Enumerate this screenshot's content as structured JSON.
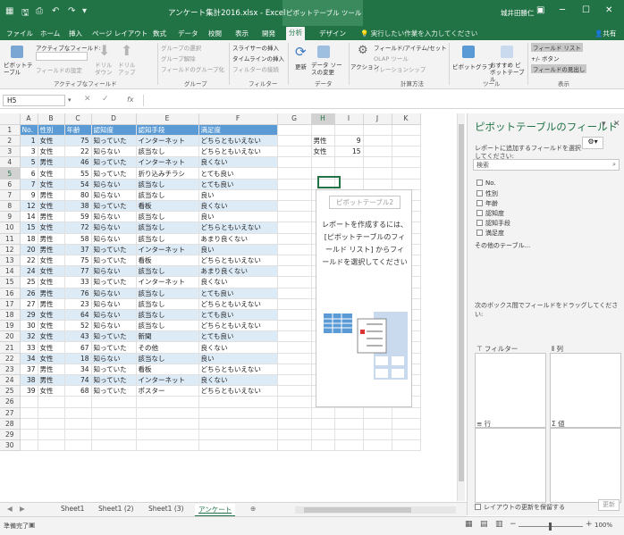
{
  "window": {
    "title": "アンケート集計2016.xlsx - Excel",
    "context_tab_group": "ピボットテーブル ツール",
    "user": "城井田勝仁"
  },
  "menu_tabs": [
    "ファイル",
    "ホーム",
    "挿入",
    "ページ レイアウト",
    "数式",
    "データ",
    "校閲",
    "表示",
    "開発",
    "分析",
    "デザイン"
  ],
  "tell_me": "実行したい作業を入力してください",
  "share": "共有",
  "ribbon": {
    "pivot_name_label": "アクティブなフィールド:",
    "pivot_btn": "ピボットテーブル",
    "field_settings": "フィールドの設定",
    "drill_down": "ドリル ダウン",
    "drill_up": "ドリル アップ",
    "group_selection": "グループの選択",
    "ungroup": "グループ解除",
    "group_field": "フィールドのグループ化",
    "insert_slicer": "スライサーの挿入",
    "insert_timeline": "タイムラインの挿入",
    "filter_conn": "フィルターの接続",
    "refresh": "更新",
    "change_source": "データ ソースの変更",
    "actions": "アクション",
    "fields_items": "フィールド/アイテム/セット",
    "olap": "OLAP ツール",
    "relationships": "リレーションシップ",
    "pivot_chart": "ピボットグラフ",
    "recommended": "おすすめ ピボットテーブル",
    "field_list": "フィールド リスト",
    "buttons": "+/- ボタン",
    "field_headers": "フィールドの見出し",
    "groups": [
      "アクティブなフィールド",
      "グループ",
      "フィルター",
      "データ",
      "計算方法",
      "ツール",
      "表示"
    ]
  },
  "namebox": "H5",
  "fx": "fx",
  "columns": [
    "A",
    "B",
    "C",
    "D",
    "E",
    "F",
    "G",
    "H",
    "I",
    "J",
    "K"
  ],
  "selected_column": "H",
  "selected_row": "5",
  "table_header": [
    "No.",
    "性別",
    "年齢",
    "認知度",
    "認知手段",
    "満足度"
  ],
  "rows": [
    [
      "1",
      "女性",
      "75",
      "知っていた",
      "インターネット",
      "どちらともいえない"
    ],
    [
      "3",
      "女性",
      "22",
      "知らない",
      "該当なし",
      "どちらともいえない"
    ],
    [
      "5",
      "男性",
      "46",
      "知っていた",
      "インターネット",
      "良くない"
    ],
    [
      "6",
      "女性",
      "55",
      "知っていた",
      "折り込みチラシ",
      "とても良い"
    ],
    [
      "7",
      "女性",
      "54",
      "知らない",
      "該当なし",
      "とても良い"
    ],
    [
      "9",
      "男性",
      "80",
      "知らない",
      "該当なし",
      "良い"
    ],
    [
      "12",
      "女性",
      "38",
      "知っていた",
      "看板",
      "良くない"
    ],
    [
      "14",
      "男性",
      "59",
      "知らない",
      "該当なし",
      "良い"
    ],
    [
      "15",
      "女性",
      "72",
      "知らない",
      "該当なし",
      "どちらともいえない"
    ],
    [
      "18",
      "男性",
      "58",
      "知らない",
      "該当なし",
      "あまり良くない"
    ],
    [
      "20",
      "男性",
      "37",
      "知っていた",
      "インターネット",
      "良い"
    ],
    [
      "22",
      "女性",
      "75",
      "知っていた",
      "看板",
      "どちらともいえない"
    ],
    [
      "24",
      "女性",
      "77",
      "知らない",
      "該当なし",
      "あまり良くない"
    ],
    [
      "25",
      "女性",
      "33",
      "知っていた",
      "インターネット",
      "良くない"
    ],
    [
      "26",
      "男性",
      "76",
      "知らない",
      "該当なし",
      "とても良い"
    ],
    [
      "27",
      "男性",
      "23",
      "知らない",
      "該当なし",
      "どちらともいえない"
    ],
    [
      "29",
      "女性",
      "64",
      "知らない",
      "該当なし",
      "とても良い"
    ],
    [
      "30",
      "女性",
      "52",
      "知らない",
      "該当なし",
      "どちらともいえない"
    ],
    [
      "32",
      "女性",
      "43",
      "知っていた",
      "新聞",
      "とても良い"
    ],
    [
      "33",
      "女性",
      "67",
      "知っていた",
      "その他",
      "良くない"
    ],
    [
      "34",
      "女性",
      "18",
      "知らない",
      "該当なし",
      "良い"
    ],
    [
      "37",
      "男性",
      "34",
      "知っていた",
      "看板",
      "どちらともいえない"
    ],
    [
      "38",
      "男性",
      "74",
      "知っていた",
      "インターネット",
      "良くない"
    ],
    [
      "39",
      "女性",
      "68",
      "知っていた",
      "ポスター",
      "どちらともいえない"
    ]
  ],
  "side_counts": [
    [
      "男性",
      "9"
    ],
    [
      "女性",
      "15"
    ]
  ],
  "pivot": {
    "name": "ピボットテーブル2",
    "help": "レポートを作成するには、[ピボットテーブルのフィールド リスト] からフィールドを選択してください"
  },
  "pane": {
    "title": "ピボットテーブルのフィールド",
    "subtitle": "レポートに追加するフィールドを選択してください:",
    "search": "検索",
    "fields": [
      "No.",
      "性別",
      "年齢",
      "認知度",
      "認知手段",
      "満足度"
    ],
    "more_tables": "その他のテーブル...",
    "drag_hint": "次のボックス間でフィールドをドラッグしてください:",
    "areas": [
      "フィルター",
      "列",
      "行",
      "Σ 値"
    ],
    "defer": "レイアウトの更新を保留する",
    "update": "更新"
  },
  "sheets": [
    "Sheet1",
    "Sheet1 (2)",
    "Sheet1 (3)",
    "アンケート"
  ],
  "active_sheet": "アンケート",
  "status": {
    "ready": "準備完了",
    "zoom": "100%"
  },
  "colors": {
    "excel_green": "#217346",
    "table_header": "#5b9bd5",
    "band": "#ddebf7"
  }
}
